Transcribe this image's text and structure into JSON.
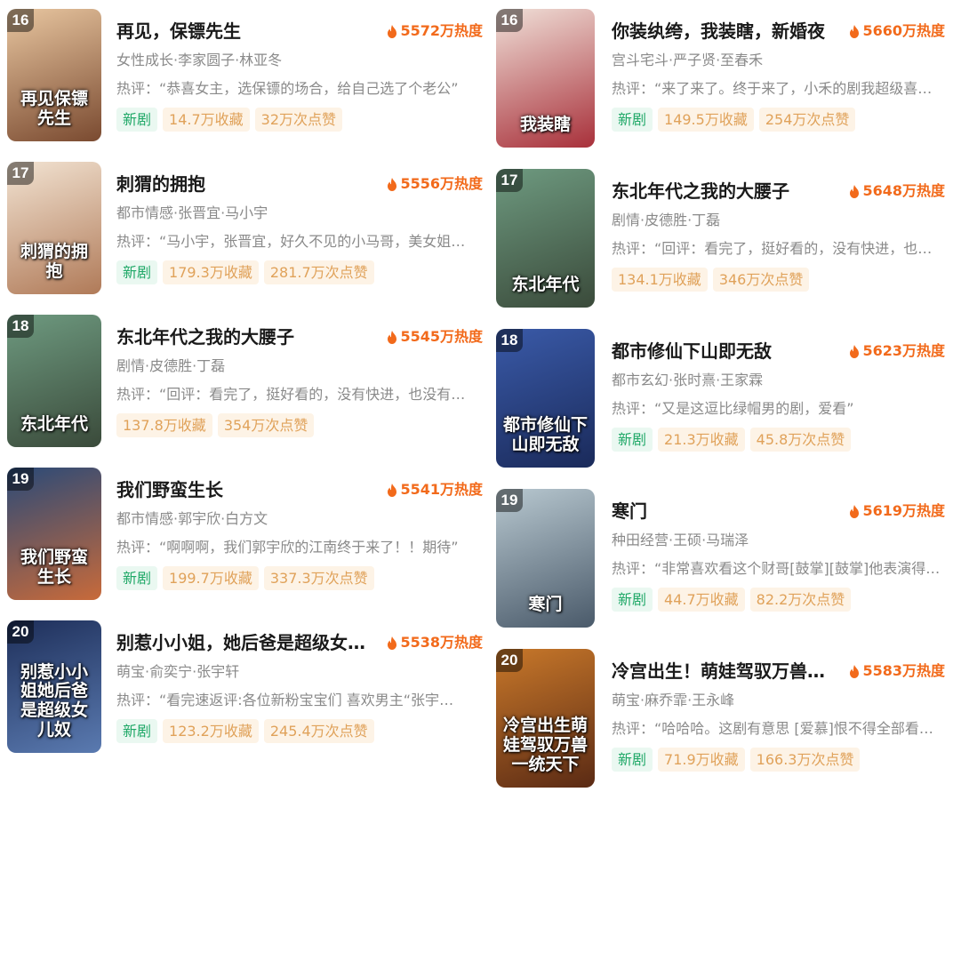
{
  "left_column": [
    {
      "rank": "16",
      "title": "再见，保镖先生",
      "heat": "5572万热度",
      "meta": "女性成长·李家圆子·林亚冬",
      "review": "热评：“恭喜女主，选保镖的场合，给自己选了个老公”",
      "tags": [
        "新剧",
        "14.7万收藏",
        "32万次点赞"
      ],
      "poster_text": "再见保镖先生",
      "poster_colors": [
        "#e8c6a0",
        "#7a4a30"
      ]
    },
    {
      "rank": "17",
      "title": "刺猬的拥抱",
      "heat": "5556万热度",
      "meta": "都市情感·张晋宜·马小宇",
      "review": "热评：“马小宇，张晋宜，好久不见的小马哥，美女姐姐”",
      "tags": [
        "新剧",
        "179.3万收藏",
        "281.7万次点赞"
      ],
      "poster_text": "刺猬的拥抱",
      "poster_colors": [
        "#f2e3d2",
        "#b07a58"
      ]
    },
    {
      "rank": "18",
      "title": "东北年代之我的大腰子",
      "heat": "5545万热度",
      "meta": "剧情·皮德胜·丁磊",
      "review": "热评：“回评：看完了，挺好看的，没有快进，也没有跳着看”",
      "tags": [
        "",
        "137.8万收藏",
        "354万次点赞"
      ],
      "poster_text": "东北年代",
      "poster_colors": [
        "#6e9a80",
        "#3a4a3a"
      ]
    },
    {
      "rank": "19",
      "title": "我们野蛮生长",
      "heat": "5541万热度",
      "meta": "都市情感·郭宇欣·白方文",
      "review": "热评：“啊啊啊，我们郭宇欣的江南终于来了！！期待”",
      "tags": [
        "新剧",
        "199.7万收藏",
        "337.3万次点赞"
      ],
      "poster_text": "我们野蛮生长",
      "poster_colors": [
        "#2a4a78",
        "#c86a3a"
      ]
    },
    {
      "rank": "20",
      "title": "别惹小小姐，她后爸是超级女儿奴",
      "heat": "5538万热度",
      "meta": "萌宝·俞奕宁·张宇轩",
      "review": "热评：“看完速返评:各位新粉宝宝们 喜欢男主“张宇轩”的”",
      "tags": [
        "新剧",
        "123.2万收藏",
        "245.4万次点赞"
      ],
      "poster_text": "别惹小小姐她后爸是超级女儿奴",
      "poster_colors": [
        "#1e2f5a",
        "#5a7ab0"
      ]
    }
  ],
  "right_column": [
    {
      "rank": "16",
      "title": "你装纨绔，我装瞎，新婚夜",
      "heat": "5660万热度",
      "meta": "宫斗宅斗·严子贤·至春禾",
      "review": "热评：“来了来了。终于来了，小禾的剧我超级喜欢的”",
      "tags": [
        "新剧",
        "149.5万收藏",
        "254万次点赞"
      ],
      "poster_text": "我装瞎",
      "poster_colors": [
        "#f0e0d8",
        "#a8303a"
      ]
    },
    {
      "rank": "17",
      "title": "东北年代之我的大腰子",
      "heat": "5648万热度",
      "meta": "剧情·皮德胜·丁磊",
      "review": "热评：“回评：看完了，挺好看的，没有快进，也没有跳着看”",
      "tags": [
        "",
        "134.1万收藏",
        "346万次点赞"
      ],
      "poster_text": "东北年代",
      "poster_colors": [
        "#6e9a80",
        "#3a4a3a"
      ]
    },
    {
      "rank": "18",
      "title": "都市修仙下山即无敌",
      "heat": "5623万热度",
      "meta": "都市玄幻·张时熹·王家霖",
      "review": "热评：“又是这逗比绿帽男的剧，爱看”",
      "tags": [
        "新剧",
        "21.3万收藏",
        "45.8万次点赞"
      ],
      "poster_text": "都市修仙下山即无敌",
      "poster_colors": [
        "#3a5aa8",
        "#1a2a5a"
      ]
    },
    {
      "rank": "19",
      "title": "寒门",
      "heat": "5619万热度",
      "meta": "种田经营·王硕·马瑞泽",
      "review": "热评：“非常喜欢看这个财哥[鼓掌][鼓掌]他表演得真好”",
      "tags": [
        "新剧",
        "44.7万收藏",
        "82.2万次点赞"
      ],
      "poster_text": "寒门",
      "poster_colors": [
        "#b8c8d0",
        "#4a5a6a"
      ]
    },
    {
      "rank": "20",
      "title": "冷宫出生！萌娃驾驭万兽一统天下",
      "heat": "5583万热度",
      "meta": "萌宝·麻乔霏·王永峰",
      "review": "热评：“哈哈哈。这剧有意思 [爱慕]恨不得全部看完”",
      "tags": [
        "新剧",
        "71.9万收藏",
        "166.3万次点赞"
      ],
      "poster_text": "冷宫出生萌娃驾驭万兽一统天下",
      "poster_colors": [
        "#c8782a",
        "#5a2a14"
      ]
    }
  ]
}
